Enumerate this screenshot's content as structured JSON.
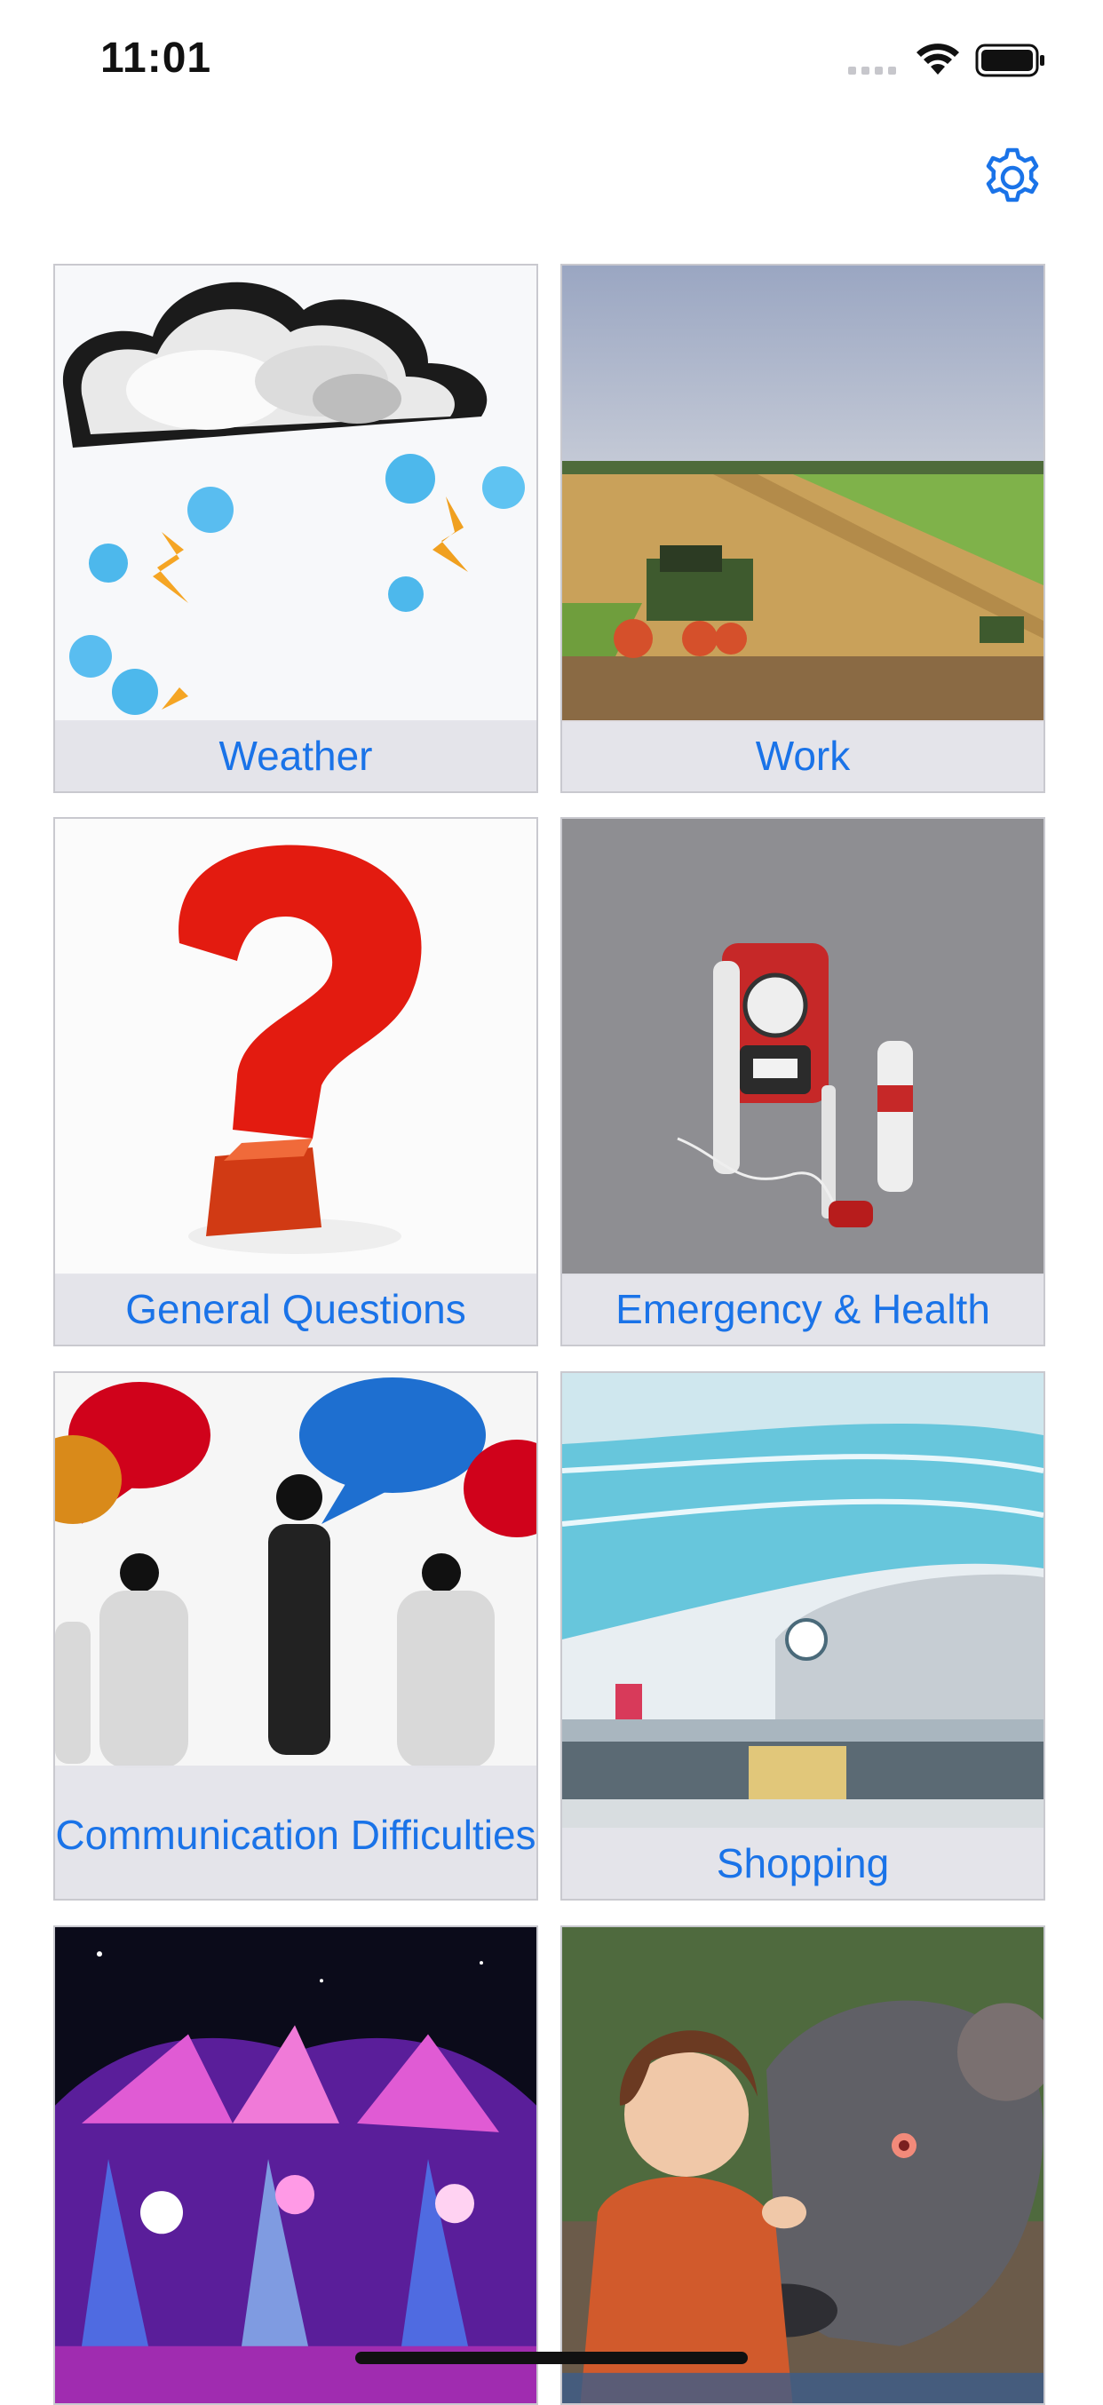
{
  "status_bar": {
    "time": "11:01"
  },
  "header": {
    "settings_icon": "gear-icon",
    "accent_color": "#1a73e8"
  },
  "categories": [
    {
      "label": "Weather"
    },
    {
      "label": "Work"
    },
    {
      "label": "General Questions"
    },
    {
      "label": "Emergency & Health"
    },
    {
      "label": "Communication Difficulties"
    },
    {
      "label": "Shopping"
    },
    {
      "label": ""
    },
    {
      "label": ""
    }
  ]
}
